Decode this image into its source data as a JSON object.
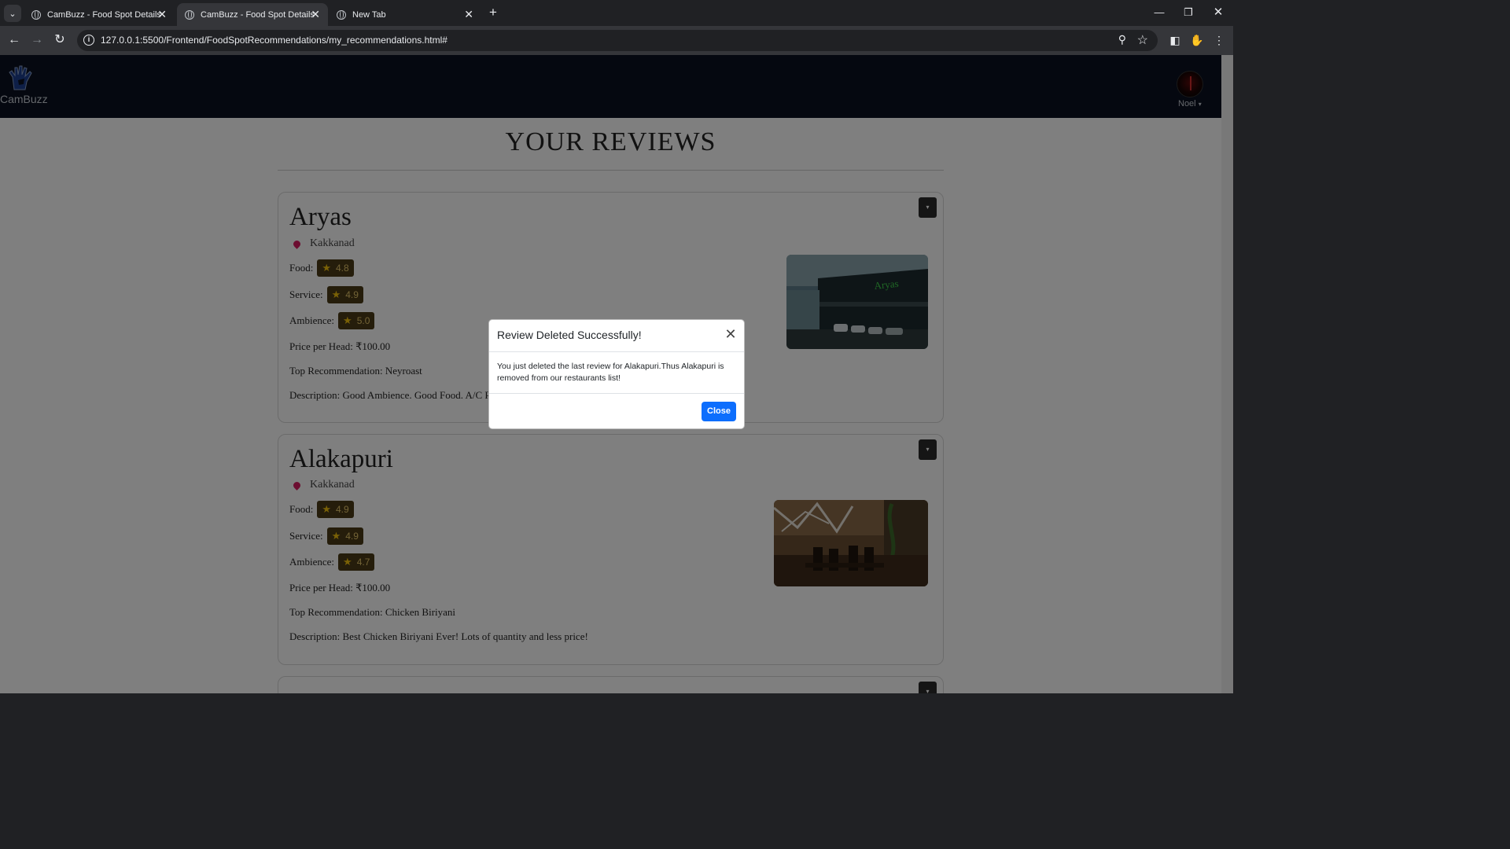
{
  "browser": {
    "tabs": [
      {
        "title": "CamBuzz - Food Spot Details",
        "active": false
      },
      {
        "title": "CamBuzz - Food Spot Details",
        "active": true
      },
      {
        "title": "New Tab",
        "active": false
      }
    ],
    "new_tab_label": "+",
    "url": "127.0.0.1:5500/Frontend/FoodSpotRecommendations/my_recommendations.html#"
  },
  "site": {
    "logo_text": "CamBuzz",
    "user_name": "Noel"
  },
  "page": {
    "title": "YOUR REVIEWS"
  },
  "labels": {
    "food": "Food:",
    "service": "Service:",
    "ambience": "Ambience:"
  },
  "reviews": [
    {
      "name": "Aryas",
      "location": "Kakkanad",
      "food": "4.8",
      "service": "4.9",
      "ambience": "5.0",
      "price": "Price per Head: ₹100.00",
      "top": "Top Recommendation: Neyroast",
      "description": "Description: Good Ambience. Good Food. A/C Restaurant."
    },
    {
      "name": "Alakapuri",
      "location": "Kakkanad",
      "food": "4.9",
      "service": "4.9",
      "ambience": "4.7",
      "price": "Price per Head: ₹100.00",
      "top": "Top Recommendation: Chicken Biriyani",
      "description": "Description: Best Chicken Biriyani Ever! Lots of quantity and less price!"
    }
  ],
  "modal": {
    "title": "Review Deleted Successfully!",
    "body": "You just deleted the last review for Alakapuri.Thus Alakapuri is removed from our restaurants list!",
    "close_label": "Close"
  },
  "colors": {
    "nav_bg": "#0b1120",
    "badge_bg": "#4a3b16",
    "star": "#f4c20d",
    "primary_button": "#0d6efd",
    "location_pin": "#d81b60"
  }
}
